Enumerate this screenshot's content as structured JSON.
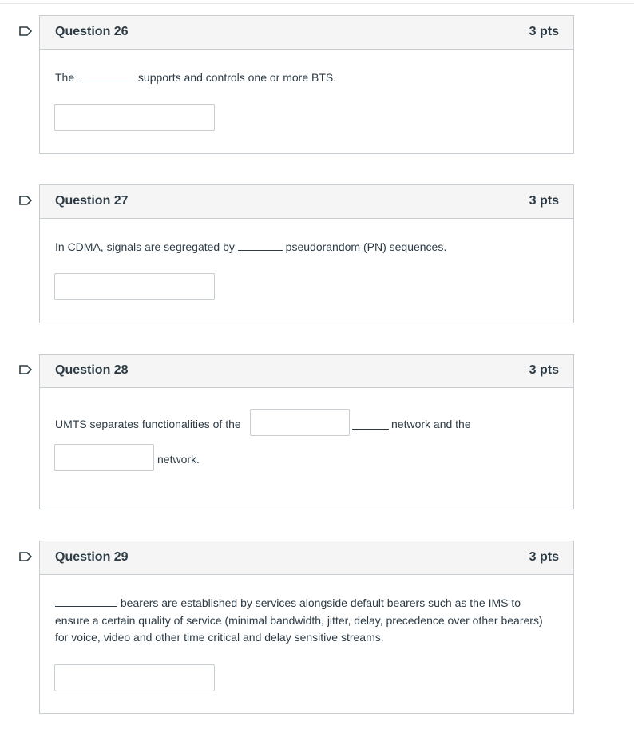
{
  "colors": {
    "flag": "#2d3b45",
    "header_bg": "#f5f5f5",
    "border": "#c7cdd1",
    "text": "#2d3b45"
  },
  "flag_icon": "flag-outline-icon",
  "questions": [
    {
      "title": "Question 26",
      "points": "3 pts",
      "text_before": "The",
      "text_after": "supports and controls one or more BTS."
    },
    {
      "title": "Question 27",
      "points": "3 pts",
      "text_before": "In CDMA, signals are segregated by",
      "text_after": "pseudorandom (PN) sequences."
    },
    {
      "title": "Question 28",
      "points": "3 pts",
      "text_before": "UMTS separates functionalities of the",
      "text_mid": "network and the",
      "text_after": "network."
    },
    {
      "title": "Question 29",
      "points": "3 pts",
      "text_line1": "bearers are established by services alongside default bearers such as the IMS to",
      "text_line2": "ensure a certain quality of service (minimal bandwidth, jitter, delay, precedence over other bearers)",
      "text_line3": "for voice, video and other time critical and delay sensitive streams."
    }
  ]
}
